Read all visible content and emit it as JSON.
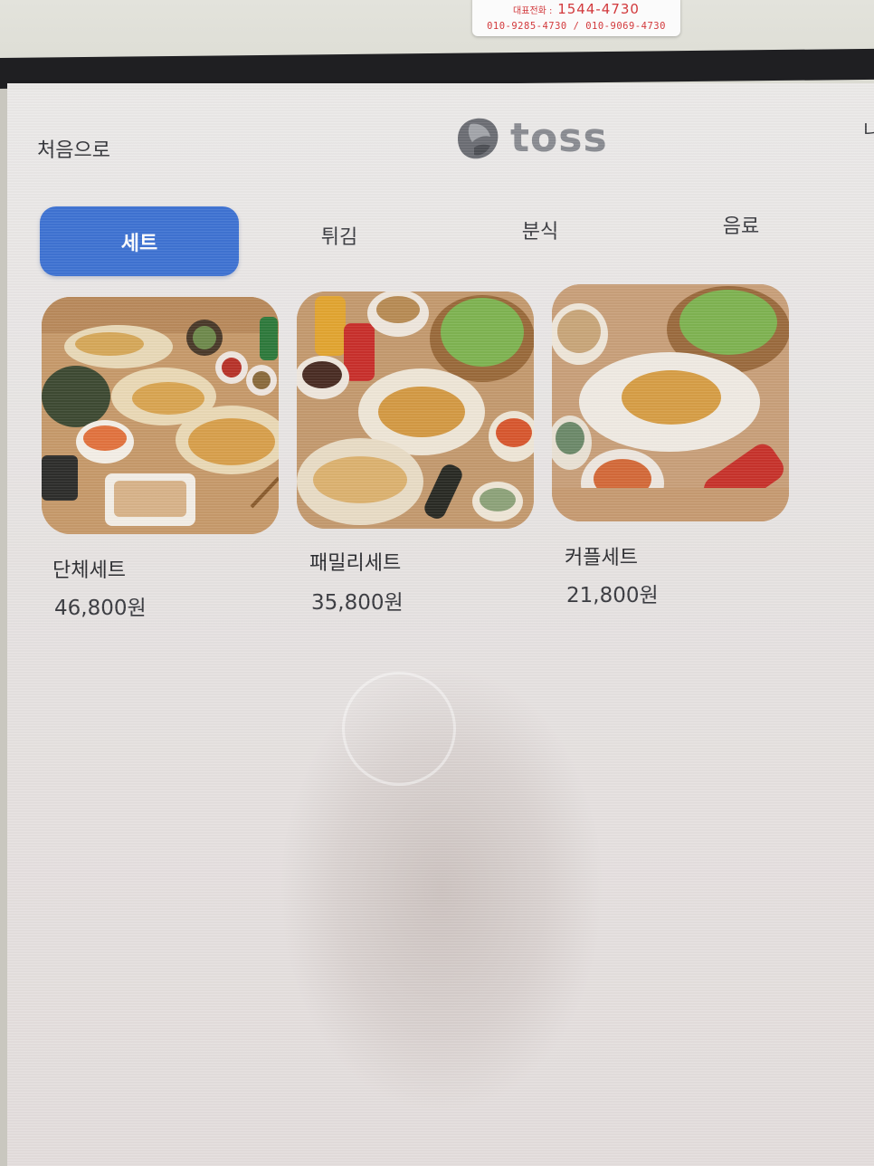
{
  "wall_sticker": {
    "main_label": "대표전화 :",
    "main_number": "1544-4730",
    "sub_numbers": "010-9285-4730 / 010-9069-4730"
  },
  "header": {
    "home_label": "처음으로",
    "brand": "toss",
    "edge_text": "니"
  },
  "tabs": [
    {
      "label": "세트",
      "active": true
    },
    {
      "label": "튀김",
      "active": false
    },
    {
      "label": "분식",
      "active": false
    },
    {
      "label": "음료",
      "active": false
    }
  ],
  "menu": [
    {
      "name": "단체세트",
      "price": "46,800원",
      "image": "group-set-photo"
    },
    {
      "name": "패밀리세트",
      "price": "35,800원",
      "image": "family-set-photo"
    },
    {
      "name": "커플세트",
      "price": "21,800원",
      "image": "couple-set-photo"
    }
  ],
  "colors": {
    "accent": "#3f73d3",
    "text": "#34353a",
    "logo": "#8a8c92"
  }
}
